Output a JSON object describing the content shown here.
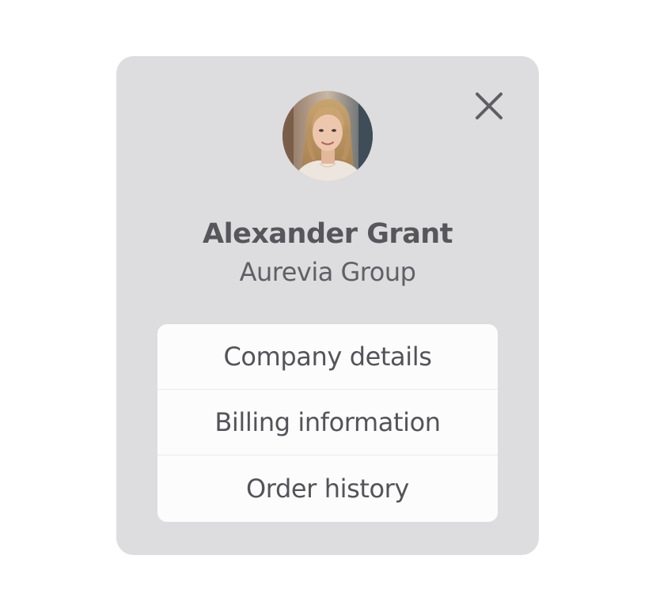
{
  "profile": {
    "name": "Alexander Grant",
    "company": "Aurevia Group",
    "avatar_icon": "user-photo"
  },
  "close_icon": "close-icon",
  "menu": {
    "items": [
      {
        "label": "Company details"
      },
      {
        "label": "Billing information"
      },
      {
        "label": "Order history"
      }
    ]
  },
  "colors": {
    "card_background": "#dddcdf",
    "menu_background": "#fcfcfd",
    "text": "#57565a"
  }
}
